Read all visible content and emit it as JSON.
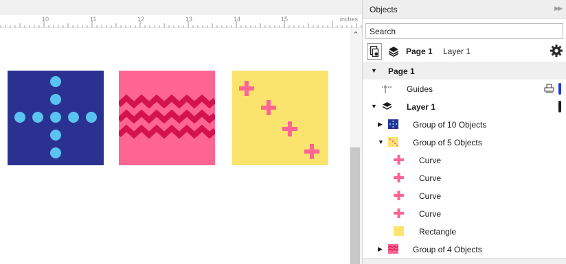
{
  "colors": {
    "navy": "#2b3191",
    "sky": "#5bc3f1",
    "pink": "#fe6593",
    "crimson": "#d4124e",
    "yellow": "#fbe46e",
    "guide_blue": "#1b36e3",
    "layer_dark": "#1a1a1a"
  },
  "ruler": {
    "numbers": [
      "10",
      "11",
      "12",
      "13",
      "14",
      "15"
    ],
    "unit": "inches"
  },
  "canvas": {
    "swatches": [
      {
        "name": "Group of 10 Objects",
        "fill": "navy",
        "pattern": "dot-cross"
      },
      {
        "name": "Group of 4 Objects",
        "fill": "pink",
        "pattern": "zigzag"
      },
      {
        "name": "Group of 5 Objects",
        "fill": "yellow",
        "pattern": "plus-diagonal"
      }
    ]
  },
  "docker": {
    "title": "Objects",
    "expand_icon": "double-chevron-right-icon",
    "search_placeholder": "Search",
    "toolbar": {
      "page": "Page 1",
      "layer": "Layer 1"
    },
    "tree": {
      "page_label": "Page 1",
      "guides_label": "Guides",
      "layer_label": "Layer 1",
      "items": [
        {
          "label": "Group of 10 Objects",
          "expanded": false
        },
        {
          "label": "Group of 5 Objects",
          "expanded": true
        },
        {
          "label": "Curve"
        },
        {
          "label": "Curve"
        },
        {
          "label": "Curve"
        },
        {
          "label": "Curve"
        },
        {
          "label": "Rectangle"
        },
        {
          "label": "Group of 4 Objects",
          "expanded": false
        }
      ]
    }
  }
}
